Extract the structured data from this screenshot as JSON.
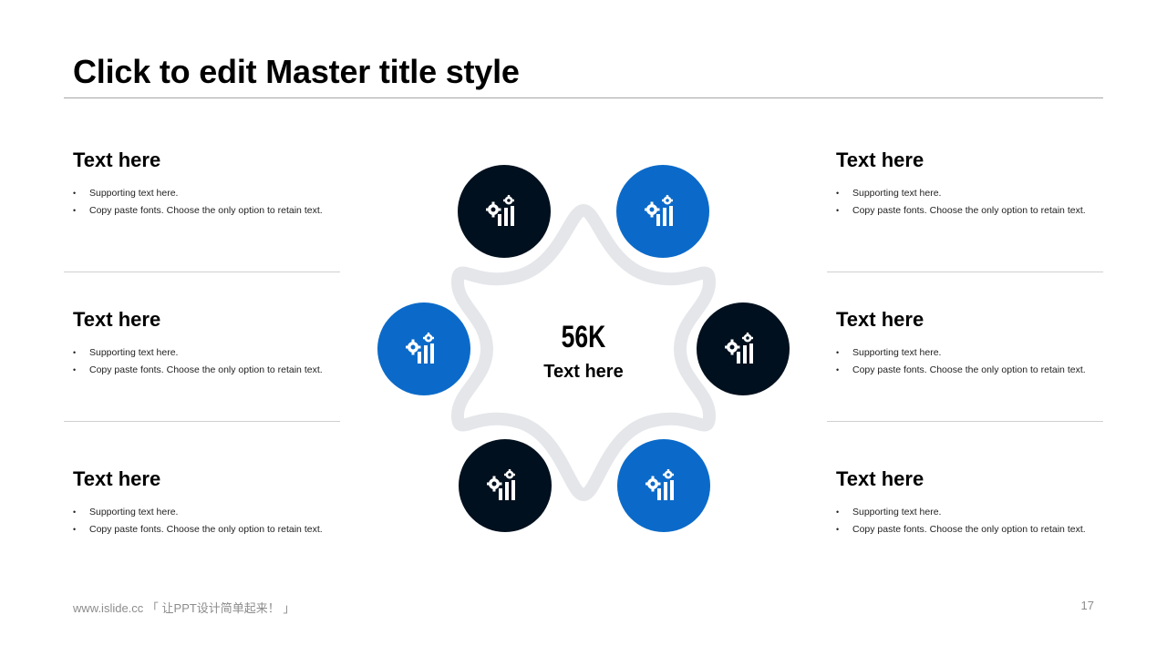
{
  "slide": {
    "title": "Click to edit Master title style",
    "page_number": "17"
  },
  "footer": {
    "text": "www.islide.cc 「 让PPT设计简单起来！ 」"
  },
  "center": {
    "value": "56K",
    "label": "Text here"
  },
  "colors": {
    "dark": "#01101e",
    "blue": "#0b6ac9",
    "ring": "#e4e6ea",
    "divider": "#d0d0d0"
  },
  "left_blocks": [
    {
      "heading": "Text here",
      "bullets": [
        "Supporting text here.",
        "Copy paste fonts. Choose the only option to retain text."
      ]
    },
    {
      "heading": "Text here",
      "bullets": [
        "Supporting text here.",
        "Copy paste fonts. Choose the only option to retain text."
      ]
    },
    {
      "heading": "Text here",
      "bullets": [
        "Supporting text here.",
        "Copy paste fonts. Choose the only option to retain text."
      ]
    }
  ],
  "right_blocks": [
    {
      "heading": "Text here",
      "bullets": [
        "Supporting text here.",
        "Copy paste fonts. Choose the only option to retain text."
      ]
    },
    {
      "heading": "Text here",
      "bullets": [
        "Supporting text here.",
        "Copy paste fonts. Choose the only option to retain text."
      ]
    },
    {
      "heading": "Text here",
      "bullets": [
        "Supporting text here.",
        "Copy paste fonts. Choose the only option to retain text."
      ]
    }
  ],
  "nodes": [
    {
      "icon": "gear-bar-chart-icon",
      "color": "dark"
    },
    {
      "icon": "gear-bar-chart-icon",
      "color": "blue"
    },
    {
      "icon": "gear-bar-chart-icon",
      "color": "blue"
    },
    {
      "icon": "gear-bar-chart-icon",
      "color": "dark"
    },
    {
      "icon": "gear-bar-chart-icon",
      "color": "dark"
    },
    {
      "icon": "gear-bar-chart-icon",
      "color": "blue"
    }
  ]
}
